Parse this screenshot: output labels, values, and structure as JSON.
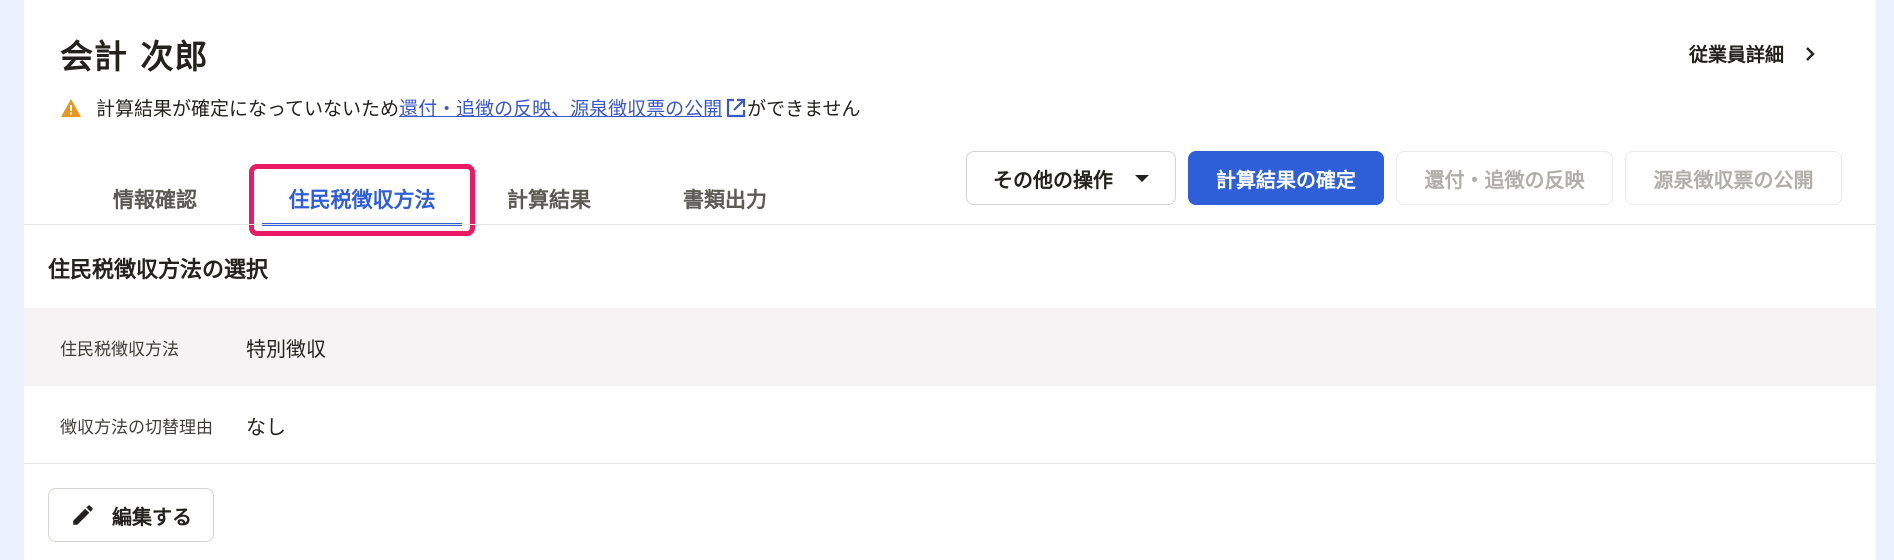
{
  "employee": {
    "name": "会計 次郎",
    "detail_link_label": "従業員詳細"
  },
  "warning": {
    "prefix": "計算結果が確定になっていないため",
    "link_text": "還付・追徴の反映、源泉徴収票の公開",
    "suffix": "ができません"
  },
  "tabs": [
    {
      "label": "情報確認",
      "active": false
    },
    {
      "label": "住民税徴収方法",
      "active": true
    },
    {
      "label": "計算結果",
      "active": false
    },
    {
      "label": "書類出力",
      "active": false
    }
  ],
  "actions": {
    "other_label": "その他の操作",
    "confirm_label": "計算結果の確定",
    "reflect_label": "還付・追徴の反映",
    "publish_label": "源泉徴収票の公開"
  },
  "section": {
    "title": "住民税徴収方法の選択",
    "rows": [
      {
        "label": "住民税徴収方法",
        "value": "特別徴収"
      },
      {
        "label": "徴収方法の切替理由",
        "value": "なし"
      }
    ]
  },
  "edit_button_label": "編集する",
  "colors": {
    "accent": "#2f5fd8",
    "highlight_border": "#e81b63",
    "warning": "#e8961e",
    "page_bg": "#eaf0fc"
  },
  "icons": {
    "warning": "warning-triangle-icon",
    "external": "external-link-icon",
    "chevron": "chevron-right-icon",
    "caret": "caret-down-icon",
    "edit": "pencil-icon"
  }
}
